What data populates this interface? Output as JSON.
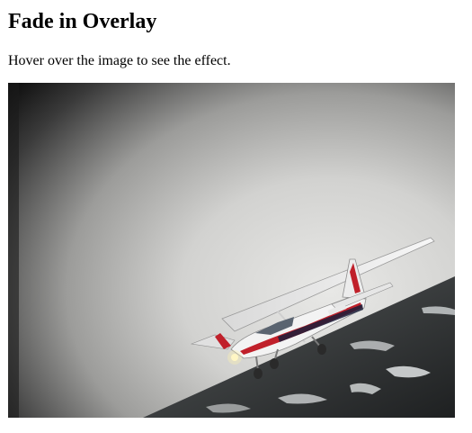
{
  "page": {
    "title": "Fade in Overlay",
    "instructions": "Hover over the image to see the effect."
  },
  "image": {
    "subject": "small-airplane-in-flight",
    "colors": {
      "sky_dark": "#0a0a0a",
      "sky_mid": "#9a9a9a",
      "sky_light": "#e4e4e4",
      "ground": "#2e3132",
      "snow": "#d6d9da",
      "wing": "#f2f2f2",
      "stripe_red": "#c0202a",
      "stripe_dark": "#1b1e3a"
    }
  },
  "overlay": {
    "color": "#008CBA"
  }
}
